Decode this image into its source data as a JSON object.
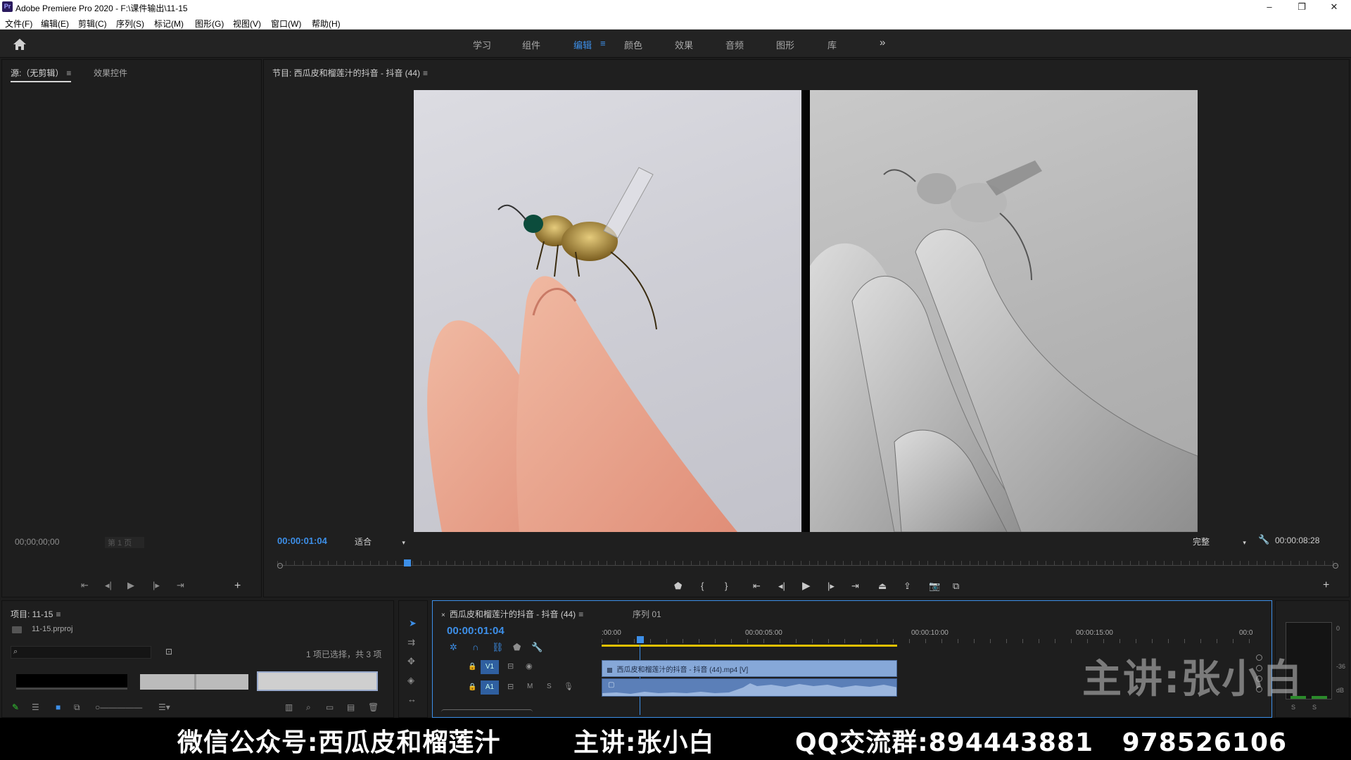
{
  "window": {
    "app_logo": "Pr",
    "title": "Adobe Premiere Pro 2020 - F:\\课件输出\\11-15"
  },
  "menu": [
    "文件(F)",
    "编辑(E)",
    "剪辑(C)",
    "序列(S)",
    "标记(M)",
    "图形(G)",
    "视图(V)",
    "窗口(W)",
    "帮助(H)"
  ],
  "workspaces": {
    "tabs": [
      "学习",
      "组件",
      "编辑",
      "颜色",
      "效果",
      "音频",
      "图形",
      "库"
    ],
    "active": "编辑",
    "more": "»",
    "menu_icon": "≡"
  },
  "source_panel": {
    "tabs": [
      "源:（无剪辑）",
      "效果控件"
    ],
    "timecode": "00;00;00;00",
    "page": "第 1 页"
  },
  "program_panel": {
    "title": "节目: 西瓜皮和榴莲汁的抖音 - 抖音 (44)",
    "timecode": "00:00:01:04",
    "fit": "适合",
    "quality": "完整",
    "duration": "00:00:08:28"
  },
  "project_panel": {
    "title": "项目: 11-15",
    "file": "11-15.prproj",
    "selection": "1 项已选择，共 3 项"
  },
  "timeline": {
    "tabs": [
      "西瓜皮和榴莲汁的抖音 - 抖音 (44)",
      "序列 01"
    ],
    "timecode": "00:00:01:04",
    "ruler": [
      ":00:00",
      "00:00:05:00",
      "00:00:10:00",
      "00:00:15:00",
      "00:0"
    ],
    "tracks": {
      "v1": "V1",
      "a1": "A1",
      "m": "M",
      "s": "S"
    },
    "clip_label": "西瓜皮和榴莲汁的抖音 - 抖音 (44).mp4 [V]"
  },
  "meter": {
    "labels": [
      "0",
      "-36",
      "dB"
    ],
    "solo": [
      "S",
      "S"
    ]
  },
  "watermark": "主讲:张小白",
  "caption": {
    "wechat": "微信公众号:西瓜皮和榴莲汁",
    "lecturer": "主讲:张小白",
    "qq": "QQ交流群:894443881   978526106"
  },
  "colors": {
    "accent": "#3d8fe8",
    "clip_video": "#86a8d8",
    "clip_audio": "#5b7fb8"
  }
}
